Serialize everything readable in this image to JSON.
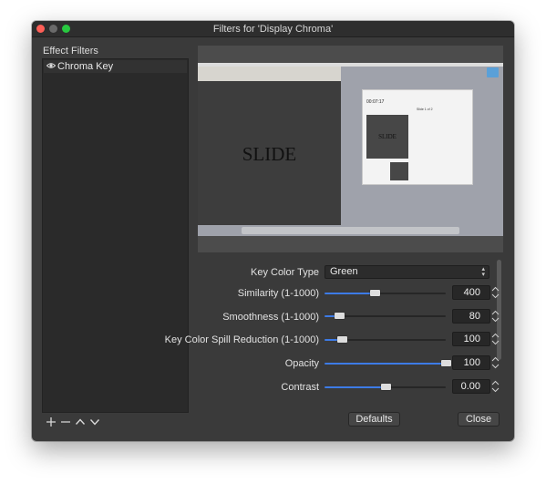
{
  "window": {
    "title": "Filters for 'Display Chroma'"
  },
  "left_panel": {
    "title": "Effect Filters",
    "filters": [
      {
        "name": "Chroma Key",
        "visible": true
      }
    ],
    "buttons": [
      "add-icon",
      "remove-icon",
      "move-up-icon",
      "move-down-icon"
    ]
  },
  "preview": {
    "slide_text": "SLIDE",
    "thumb_text": "SLIDE",
    "popup_time": "00:07:17",
    "popup_right": "Slide 1 of 2"
  },
  "properties": {
    "key_color_type": {
      "label": "Key Color Type",
      "value": "Green"
    },
    "similarity": {
      "label": "Similarity (1-1000)",
      "value": "400",
      "fraction": 0.41
    },
    "smoothness": {
      "label": "Smoothness (1-1000)",
      "value": "80",
      "fraction": 0.12
    },
    "spill": {
      "label": "Key Color Spill Reduction (1-1000)",
      "value": "100",
      "fraction": 0.14
    },
    "opacity": {
      "label": "Opacity",
      "value": "100",
      "fraction": 1.0
    },
    "contrast": {
      "label": "Contrast",
      "value": "0.00",
      "fraction": 0.5
    }
  },
  "buttons": {
    "defaults": "Defaults",
    "close": "Close"
  },
  "colors": {
    "accent": "#3d7be6",
    "window_bg": "#3a3a3a"
  }
}
